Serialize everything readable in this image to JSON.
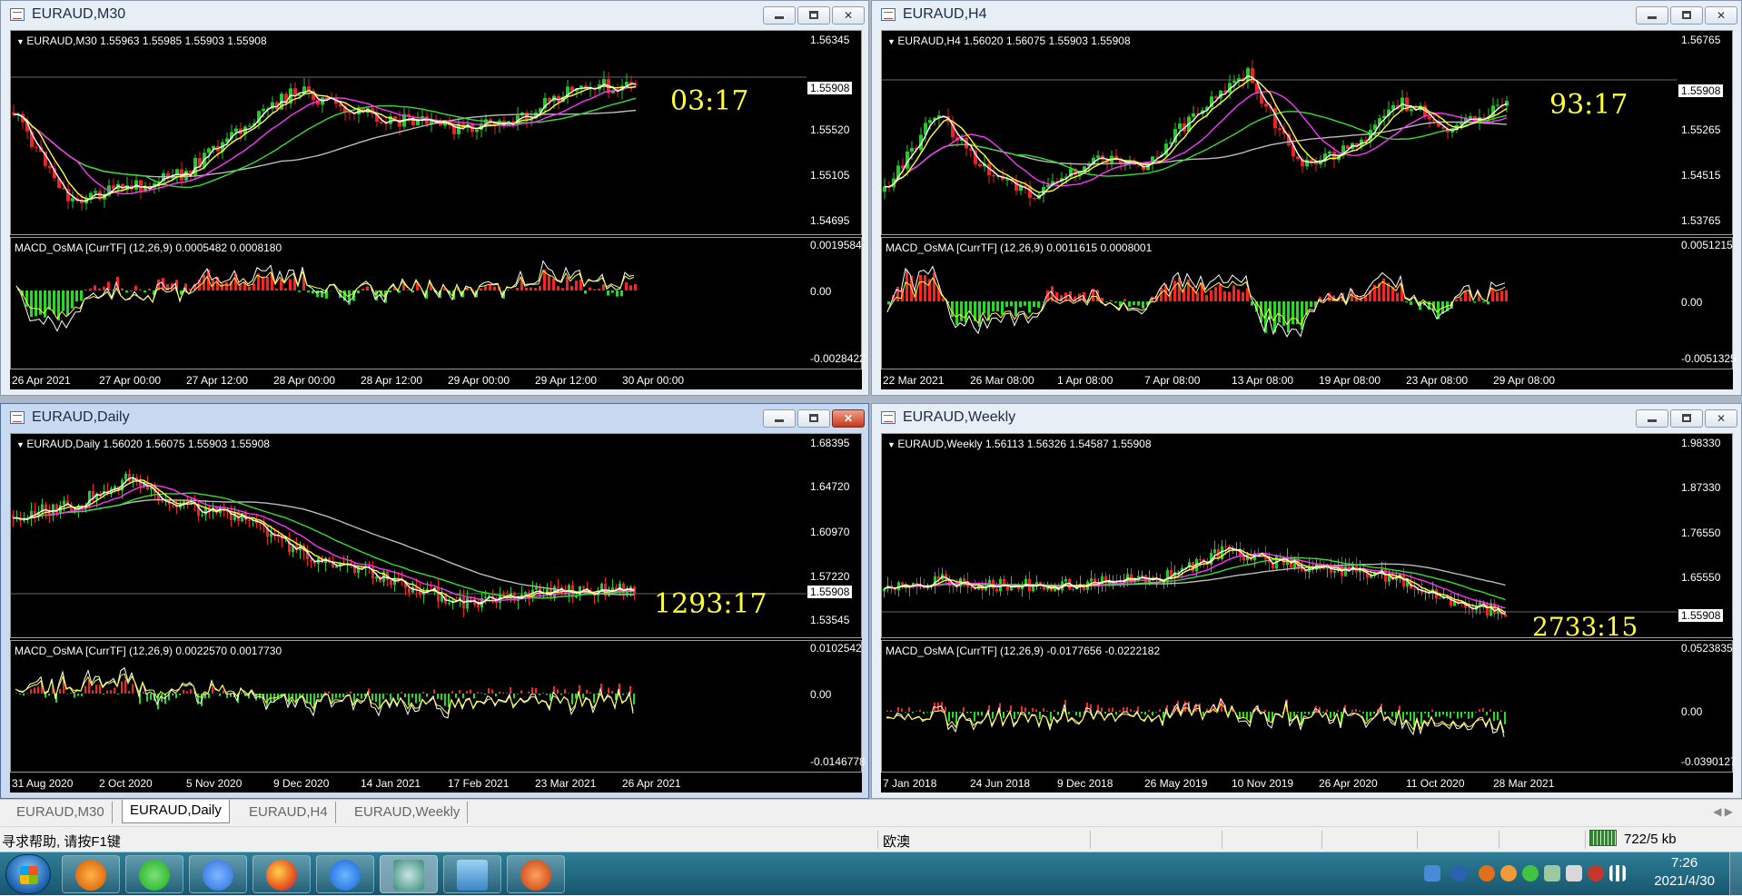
{
  "colors": {
    "chart_bg": "#000000",
    "bull_candle": "#22cc22",
    "bear_candle": "#ee2222",
    "ma_yellow": "#ffff33",
    "ma_white": "#ffffff",
    "ma_magenta": "#ff33ff",
    "ma_green": "#33dd33",
    "ma_grey": "#bbbbbb",
    "countdown": "#ffff33",
    "macd_up": "#ff2222",
    "macd_down": "#22dd22"
  },
  "windows": [
    {
      "id": "m30",
      "title": "EURAUD,M30",
      "ohlc": "EURAUD,M30  1.55963 1.55985 1.55903 1.55908",
      "price_ticks": [
        "1.56345",
        "1.55520",
        "1.55105",
        "1.54695"
      ],
      "current_price": "1.55908",
      "countdown": "03:17",
      "macd_label": "MACD_OsMA [CurrTF] (12,26,9) 0.0005482 0.0008180",
      "macd_ticks": [
        "0.0019584",
        "0.00",
        "-0.0028422"
      ],
      "x_ticks": [
        "26 Apr 2021",
        "27 Apr 00:00",
        "27 Apr 12:00",
        "28 Apr 00:00",
        "28 Apr 12:00",
        "29 Apr 00:00",
        "29 Apr 12:00",
        "30 Apr 00:00"
      ]
    },
    {
      "id": "h4",
      "title": "EURAUD,H4",
      "ohlc": "EURAUD,H4  1.56020 1.56075 1.55903 1.55908",
      "price_ticks": [
        "1.56765",
        "1.55265",
        "1.54515",
        "1.53765"
      ],
      "current_price": "1.55908",
      "countdown": "93:17",
      "macd_label": "MACD_OsMA [CurrTF] (12,26,9) 0.0011615 0.0008001",
      "macd_ticks": [
        "0.0051215",
        "0.00",
        "-0.0051325"
      ],
      "x_ticks": [
        "22 Mar 2021",
        "26 Mar 08:00",
        "1 Apr 08:00",
        "7 Apr 08:00",
        "13 Apr 08:00",
        "19 Apr 08:00",
        "23 Apr 08:00",
        "29 Apr 08:00"
      ]
    },
    {
      "id": "daily",
      "title": "EURAUD,Daily",
      "ohlc": "EURAUD,Daily  1.56020 1.56075 1.55903 1.55908",
      "price_ticks": [
        "1.68395",
        "1.64720",
        "1.60970",
        "1.57220",
        "1.53545"
      ],
      "current_price": "1.55908",
      "countdown": "1293:17",
      "macd_label": "MACD_OsMA [CurrTF] (12,26,9) 0.0022570 0.0017730",
      "macd_ticks": [
        "0.0102542",
        "0.00",
        "-0.0146778"
      ],
      "x_ticks": [
        "31 Aug 2020",
        "2 Oct 2020",
        "5 Nov 2020",
        "9 Dec 2020",
        "14 Jan 2021",
        "17 Feb 2021",
        "23 Mar 2021",
        "26 Apr 2021"
      ]
    },
    {
      "id": "weekly",
      "title": "EURAUD,Weekly",
      "ohlc": "EURAUD,Weekly  1.56113 1.56326 1.54587 1.55908",
      "price_ticks": [
        "1.98330",
        "1.87330",
        "1.76550",
        "1.65550"
      ],
      "current_price": "1.55908",
      "countdown": "2733:15",
      "macd_label": "MACD_OsMA [CurrTF] (12,26,9) -0.0177656 -0.0222182",
      "macd_ticks": [
        "0.0523835",
        "0.00",
        "-0.0390127"
      ],
      "x_ticks": [
        "7 Jan 2018",
        "24 Jun 2018",
        "9 Dec 2018",
        "26 May 2019",
        "10 Nov 2019",
        "26 Apr 2020",
        "11 Oct 2020",
        "28 Mar 2021"
      ]
    }
  ],
  "tabs": [
    "EURAUD,M30",
    "EURAUD,Daily",
    "EURAUD,H4",
    "EURAUD,Weekly"
  ],
  "active_tab": "EURAUD,Daily",
  "status": {
    "help": "寻求帮助, 请按F1键",
    "symbol": "欧澳",
    "connection": "722/5 kb"
  },
  "taskbar": {
    "apps": [
      "browser-app",
      "wechat-app",
      "feishu-app",
      "firefox-app",
      "lark-app",
      "tdx-app",
      "image-viewer-app",
      "mascot-app"
    ],
    "time": "7:26",
    "date": "2021/4/30"
  }
}
